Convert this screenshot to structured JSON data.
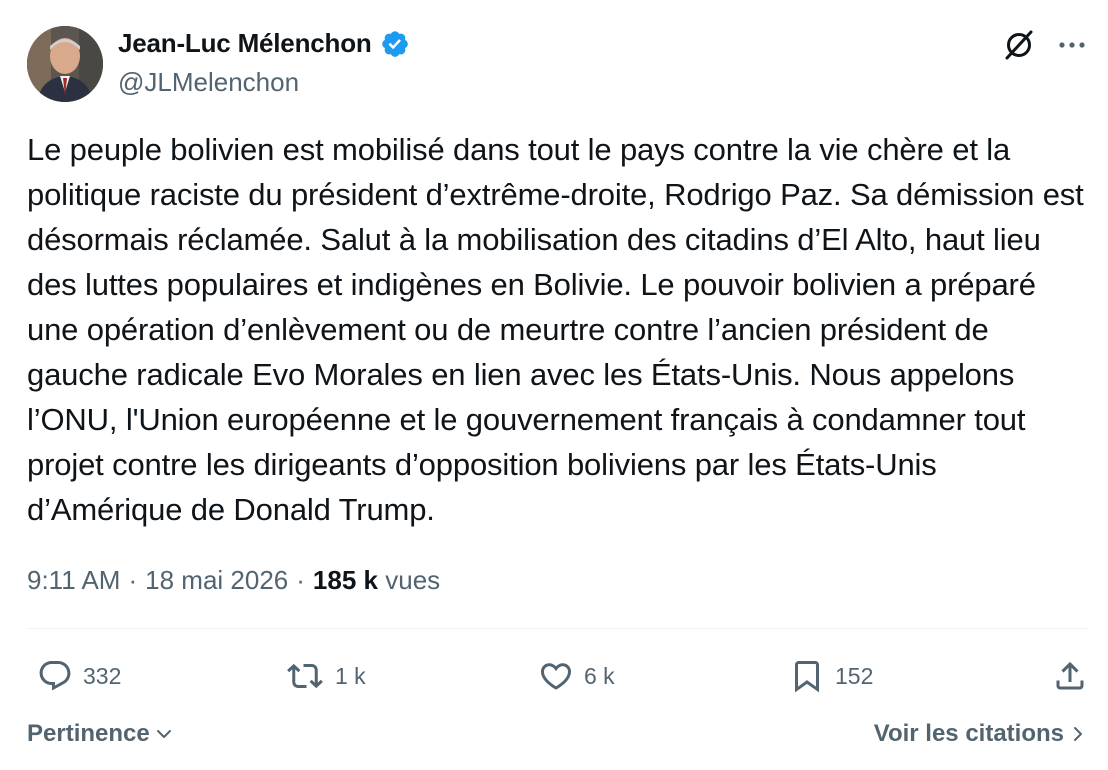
{
  "author": {
    "display_name": "Jean-Luc Mélenchon",
    "handle": "@JLMelenchon",
    "verified": true,
    "verified_color": "#1d9bf0"
  },
  "header_icons": [
    "grok-icon",
    "more-icon"
  ],
  "tweet": {
    "text": "Le peuple bolivien est mobilisé dans tout le pays contre la vie chère et la politique raciste du président d’extrême-droite, Rodrigo Paz. Sa démission est désormais réclamée. Salut à la mobilisation des citadins d’El Alto, haut lieu des luttes populaires et indigènes en Bolivie. Le pouvoir bolivien a préparé une opération d’enlèvement ou de meurtre contre l’ancien président de gauche radicale Evo Morales en lien avec les États-Unis. Nous appelons l’ONU, l'Union européenne et le gouvernement français à condamner tout projet contre les dirigeants d’opposition boliviens par les États-Unis d’Amérique de Donald Trump."
  },
  "meta": {
    "time": "9:11 AM",
    "separator": "·",
    "date": "18 mai 2026",
    "views_count": "185 k",
    "views_label": "vues"
  },
  "actions": {
    "replies": "332",
    "reposts": "1 k",
    "likes": "6 k",
    "bookmarks": "152"
  },
  "footer": {
    "sort_label": "Pertinence",
    "quotes_label": "Voir les citations"
  },
  "colors": {
    "text_primary": "#0f1419",
    "text_secondary": "#536471",
    "divider": "#eff3f4"
  }
}
